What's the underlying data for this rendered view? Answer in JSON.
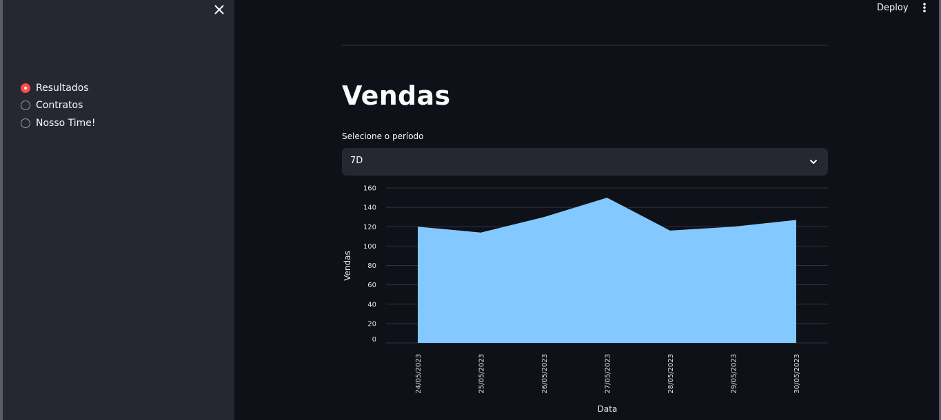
{
  "sidebar": {
    "close_icon": "close-icon",
    "navigation": [
      {
        "label": "Resultados",
        "selected": true
      },
      {
        "label": "Contratos",
        "selected": false
      },
      {
        "label": "Nosso Time!",
        "selected": false
      }
    ]
  },
  "header": {
    "deploy_label": "Deploy",
    "menu_icon": "vertical-dots-icon"
  },
  "main": {
    "title": "Vendas",
    "period_select": {
      "label": "Selecione o período",
      "value": "7D",
      "icon": "chevron-down-icon"
    }
  },
  "colors": {
    "background": "#0e1117",
    "sidebar": "#262730",
    "accent": "#ff4b4b",
    "area_fill": "#83c9ff"
  },
  "chart_data": {
    "type": "area",
    "x": [
      "24/05/2023",
      "25/05/2023",
      "26/05/2023",
      "27/05/2023",
      "28/05/2023",
      "29/05/2023",
      "30/05/2023"
    ],
    "series": [
      {
        "values": [
          120,
          114,
          130,
          150,
          116,
          120,
          127
        ]
      }
    ],
    "xlabel": "Data",
    "ylabel": "Vendas",
    "yticks": [
      0,
      20,
      40,
      60,
      80,
      100,
      120,
      140,
      160
    ],
    "ylim": [
      0,
      160
    ],
    "grid": true
  }
}
